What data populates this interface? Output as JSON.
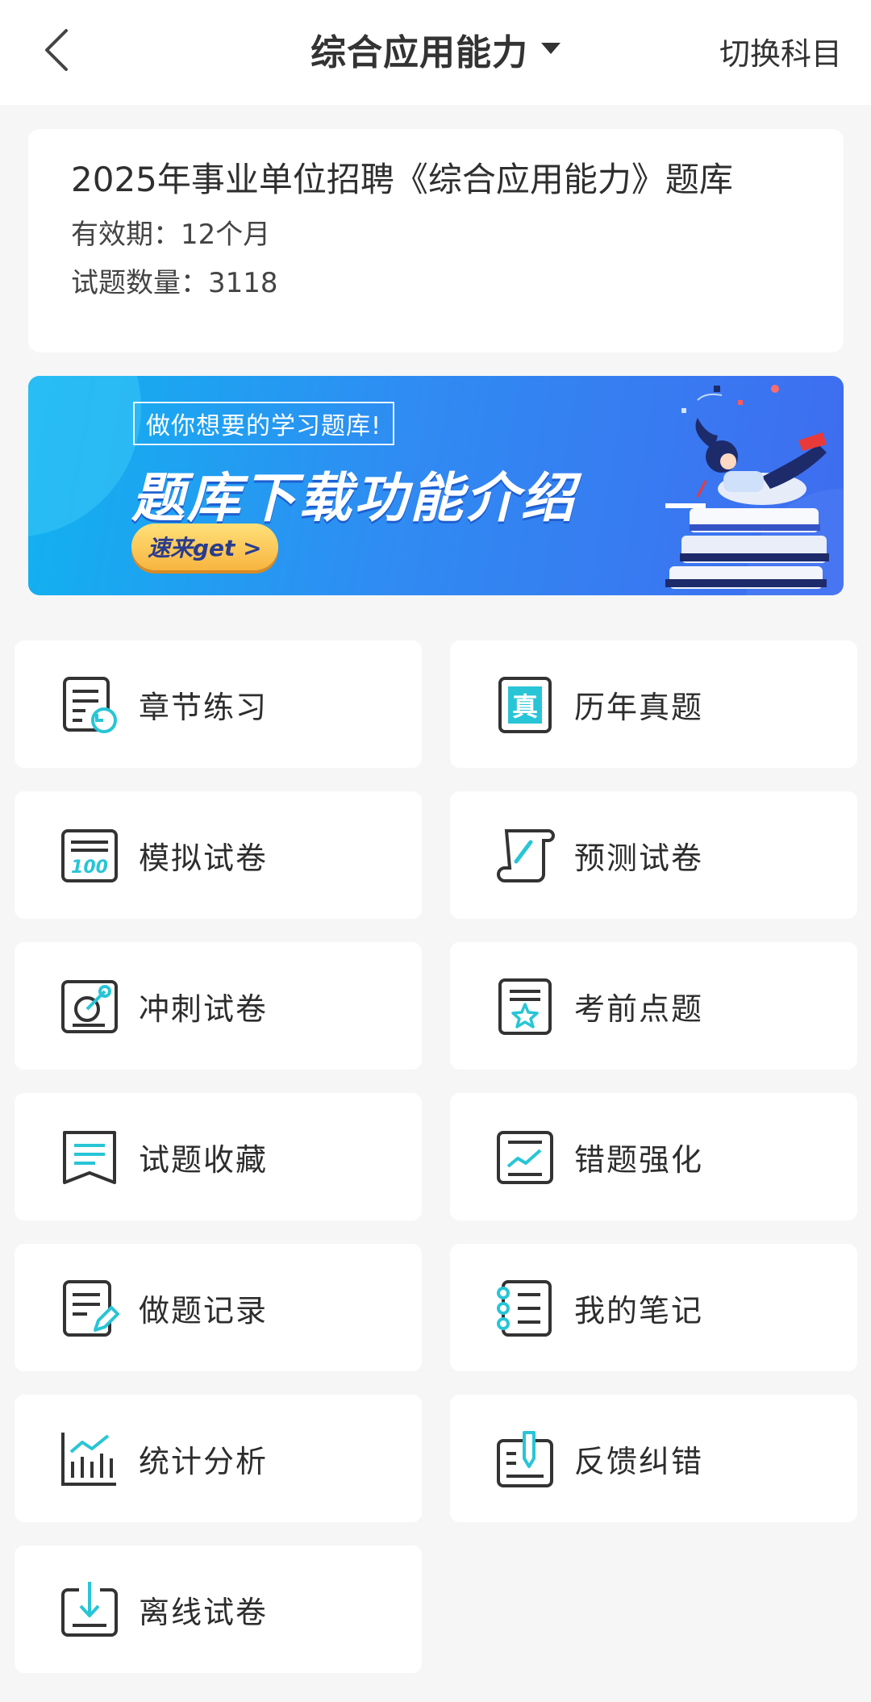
{
  "header": {
    "title": "综合应用能力",
    "switch_label": "切换科目"
  },
  "info": {
    "bank_title": "2025年事业单位招聘《综合应用能力》题库",
    "validity": "有效期：12个月",
    "question_count": "试题数量：3118"
  },
  "banner": {
    "subtitle": "做你想要的学习题库!",
    "title": "题库下载功能介绍",
    "cta": "速来get >"
  },
  "menu": [
    {
      "label": "章节练习",
      "icon": "chapter-practice-icon"
    },
    {
      "label": "历年真题",
      "icon": "past-exam-icon"
    },
    {
      "label": "模拟试卷",
      "icon": "mock-paper-icon"
    },
    {
      "label": "预测试卷",
      "icon": "prediction-paper-icon"
    },
    {
      "label": "冲刺试卷",
      "icon": "sprint-paper-icon"
    },
    {
      "label": "考前点题",
      "icon": "pre-exam-tips-icon"
    },
    {
      "label": "试题收藏",
      "icon": "bookmark-icon"
    },
    {
      "label": "错题强化",
      "icon": "wrong-questions-icon"
    },
    {
      "label": "做题记录",
      "icon": "record-icon"
    },
    {
      "label": "我的笔记",
      "icon": "notes-icon"
    },
    {
      "label": "统计分析",
      "icon": "statistics-icon"
    },
    {
      "label": "反馈纠错",
      "icon": "feedback-icon"
    },
    {
      "label": "离线试卷",
      "icon": "offline-download-icon"
    }
  ],
  "colors": {
    "accent": "#28c5d6",
    "icon_stroke": "#333333",
    "banner_start": "#11b3f0",
    "banner_end": "#3f6cf0"
  }
}
